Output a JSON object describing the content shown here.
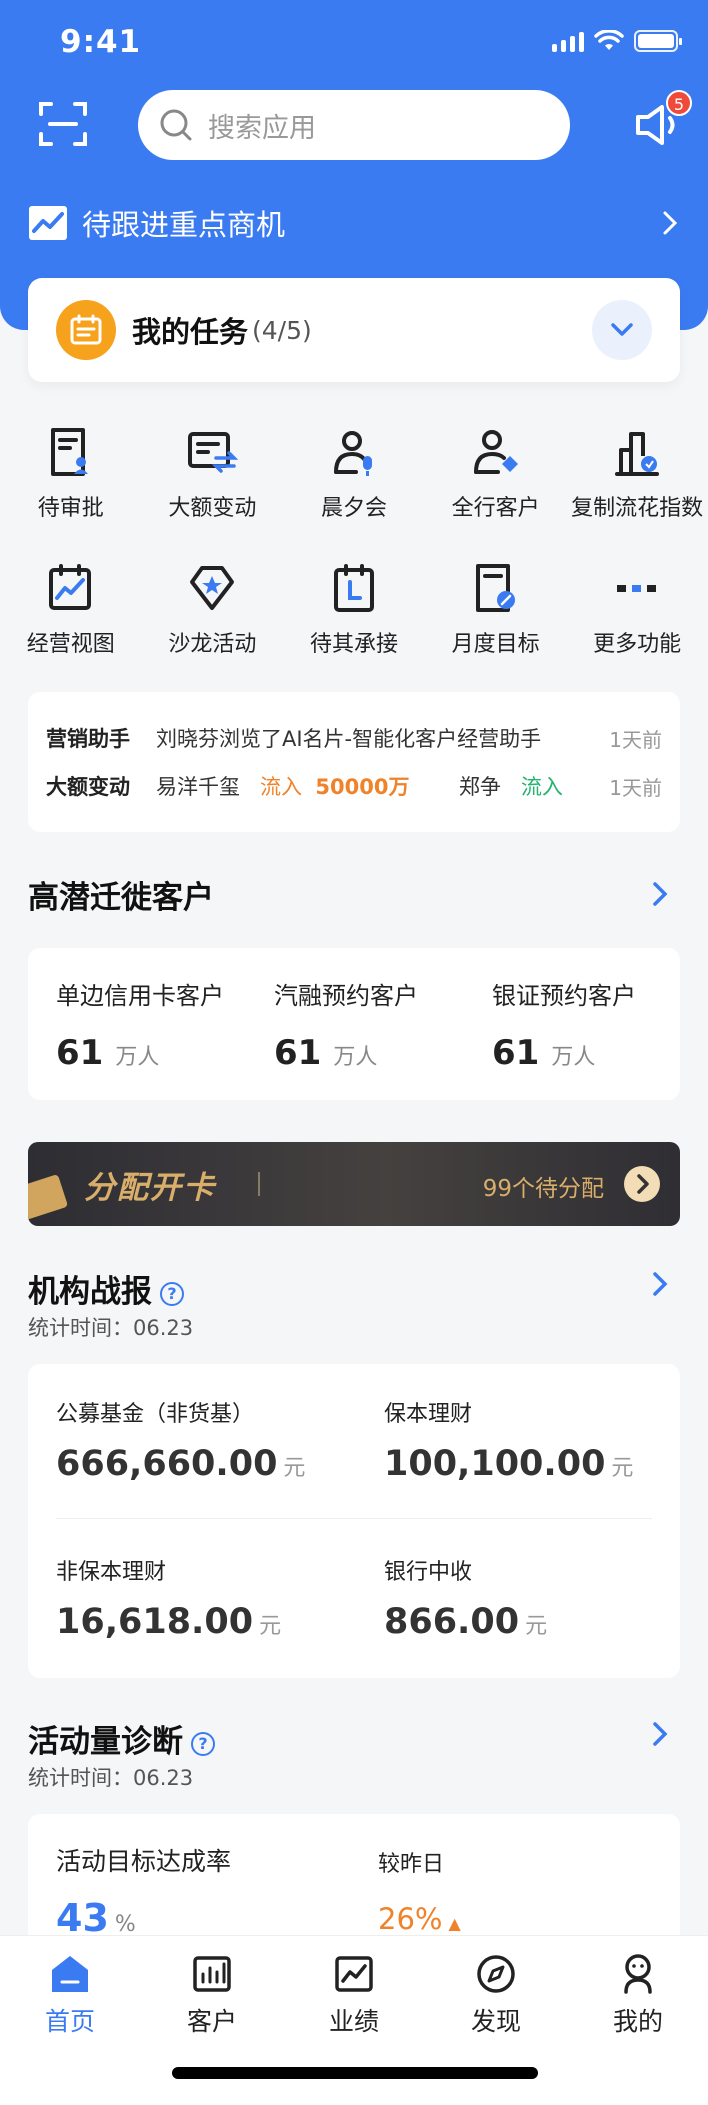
{
  "status_bar": {
    "time": "9:41"
  },
  "search": {
    "placeholder": "搜索应用"
  },
  "notifications": {
    "badge_count": "5"
  },
  "follow_link": {
    "label": "待跟进重点商机"
  },
  "tasks": {
    "title": "我的任务",
    "count": "(4/5)"
  },
  "quick_actions": [
    {
      "label": "待审批",
      "icon": "approval-icon"
    },
    {
      "label": "大额变动",
      "icon": "large-change-icon"
    },
    {
      "label": "晨夕会",
      "icon": "meeting-icon"
    },
    {
      "label": "全行客户",
      "icon": "all-customers-icon"
    },
    {
      "label": "复制流花指数",
      "icon": "index-icon"
    },
    {
      "label": "经营视图",
      "icon": "business-view-icon"
    },
    {
      "label": "沙龙活动",
      "icon": "salon-icon"
    },
    {
      "label": "待其承接",
      "icon": "handover-icon"
    },
    {
      "label": "月度目标",
      "icon": "monthly-target-icon"
    },
    {
      "label": "更多功能",
      "icon": "more-icon"
    }
  ],
  "notices": [
    {
      "tag": "营销助手",
      "text": "刘晓芬浏览了AI名片-智能化客户经营助手",
      "time": "1天前"
    },
    {
      "tag": "大额变动",
      "name1": "易洋千玺",
      "flow1": "流入",
      "amount": "50000万",
      "name2": "郑争",
      "flow2": "流入",
      "time": "1天前"
    }
  ],
  "high_potential": {
    "title": "高潜迁徙客户",
    "items": [
      {
        "label": "单边信用卡客户",
        "value": "61",
        "unit": "万人"
      },
      {
        "label": "汽融预约客户",
        "value": "61",
        "unit": "万人"
      },
      {
        "label": "银证预约客户",
        "value": "61",
        "unit": "万人"
      }
    ]
  },
  "banner": {
    "title": "分配开卡",
    "pending": "99个待分配"
  },
  "institution": {
    "title": "机构战报",
    "help": "?",
    "stat_time": "统计时间：06.23",
    "items": [
      {
        "label": "公募基金（非货基）",
        "value": "666,660.00",
        "unit": "元"
      },
      {
        "label": "保本理财",
        "value": "100,100.00",
        "unit": "元"
      },
      {
        "label": "非保本理财",
        "value": "16,618.00",
        "unit": "元"
      },
      {
        "label": "银行中收",
        "value": "866.00",
        "unit": "元"
      }
    ]
  },
  "activity": {
    "title": "活动量诊断",
    "help": "?",
    "stat_time": "统计时间：06.23",
    "rate_label": "活动目标达成率",
    "rate_value": "43",
    "rate_unit": "%",
    "compare_label": "较昨日",
    "compare_value": "26%",
    "compare_arrow": "▲"
  },
  "tabbar": [
    {
      "label": "首页",
      "icon": "home-icon",
      "active": true
    },
    {
      "label": "客户",
      "icon": "customer-icon"
    },
    {
      "label": "业绩",
      "icon": "performance-icon"
    },
    {
      "label": "发现",
      "icon": "discover-icon"
    },
    {
      "label": "我的",
      "icon": "profile-icon"
    }
  ],
  "colors": {
    "primary": "#3b7bf2",
    "accent_orange": "#f0822a",
    "inflow_green": "#22b46e",
    "banner_gold": "#d8ae6a"
  }
}
